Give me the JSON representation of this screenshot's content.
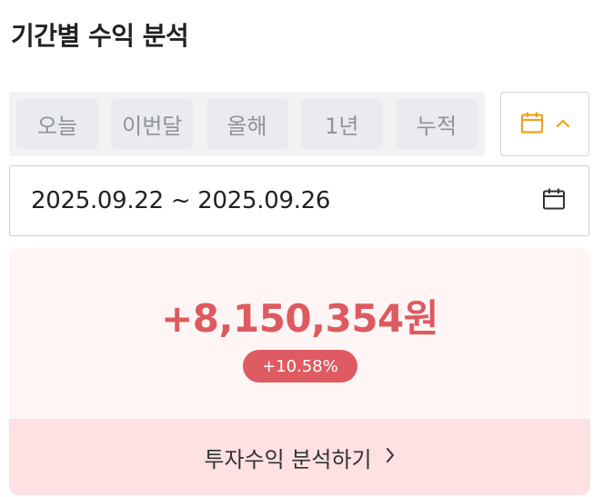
{
  "header": {
    "title": "기간별 수익 분석"
  },
  "period_tabs": [
    {
      "label": "오늘"
    },
    {
      "label": "이번달"
    },
    {
      "label": "올해"
    },
    {
      "label": "1년"
    },
    {
      "label": "누적"
    }
  ],
  "calendar_toggle": {
    "icon": "calendar-icon",
    "chevron": "chevron-up-icon",
    "accent": "#f0a020"
  },
  "date_range": {
    "value": "2025.09.22 ~ 2025.09.26",
    "icon": "calendar-icon"
  },
  "summary": {
    "profit": "+8,150,354원",
    "rate": "+10.58%",
    "profit_color": "#dd5a60",
    "link_label": "투자수익 분석하기",
    "link_icon": "chevron-right-icon"
  }
}
